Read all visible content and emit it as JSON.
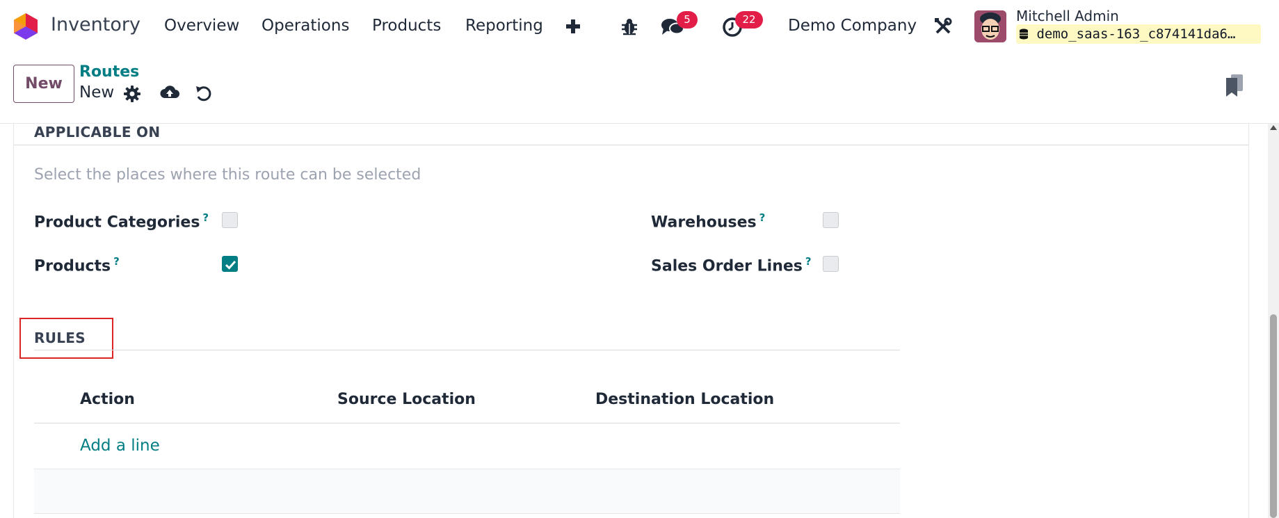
{
  "navbar": {
    "app_name": "Inventory",
    "menus": [
      "Overview",
      "Operations",
      "Products",
      "Reporting"
    ],
    "add_icon": "plus-icon",
    "debug_icon": "bug-icon",
    "messages_icon": "chat-icon",
    "messages_count": "5",
    "activities_icon": "clock-icon",
    "activities_count": "22",
    "company": "Demo Company",
    "settings_icon": "tools-icon",
    "user_name": "Mitchell Admin",
    "database": "demo_saas-163_c874141da6…"
  },
  "control_panel": {
    "new_button": "New",
    "breadcrumb_parent": "Routes",
    "breadcrumb_current": "New",
    "gear_icon": "gear-icon",
    "save_icon": "cloud-upload-icon",
    "discard_icon": "undo-icon",
    "bookmark_icon": "bookmark-icon"
  },
  "form": {
    "applicable_on": {
      "title": "APPLICABLE ON",
      "hint": "Select the places where this route can be selected",
      "help_mark": "?",
      "fields": [
        {
          "label": "Product Categories",
          "checked": false
        },
        {
          "label": "Products",
          "checked": true
        },
        {
          "label": "Warehouses",
          "checked": false
        },
        {
          "label": "Sales Order Lines",
          "checked": false
        }
      ]
    },
    "rules": {
      "title": "RULES",
      "columns": [
        "Action",
        "Source Location",
        "Destination Location"
      ],
      "add_line": "Add a line"
    }
  },
  "colors": {
    "brand": "#714b67",
    "accent": "#017e84",
    "badge": "#e11d48",
    "highlight": "#dc2626"
  }
}
